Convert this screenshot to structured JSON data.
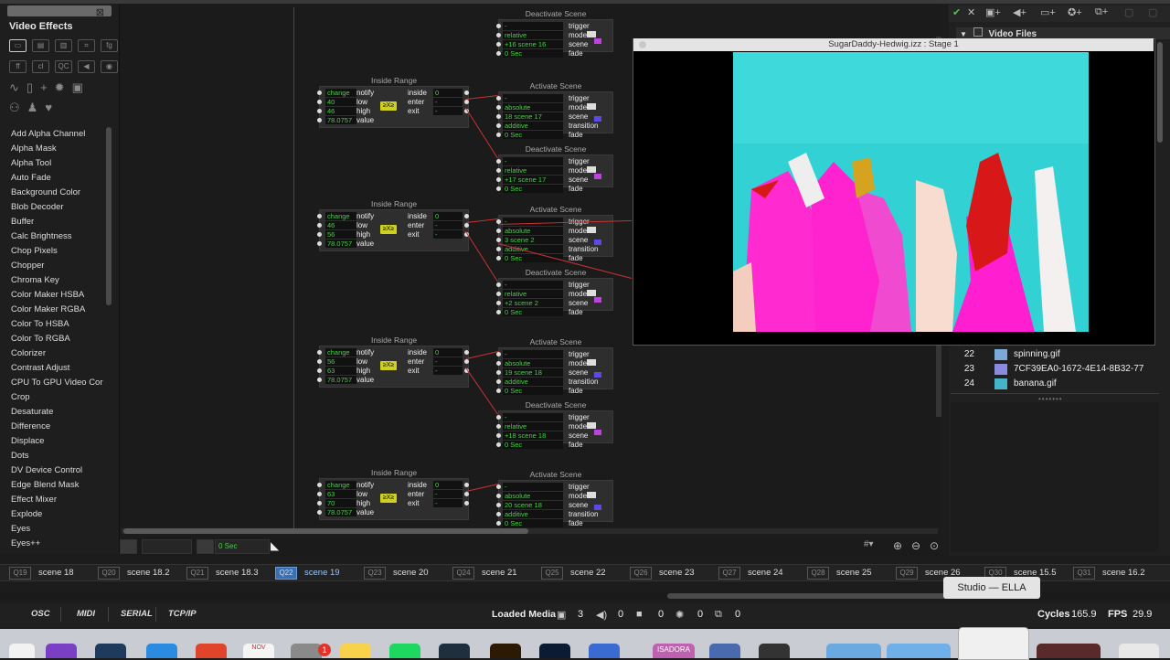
{
  "sidebar": {
    "title": "Video Effects",
    "tools_row1": [
      "▭",
      "▤",
      "▥",
      "⌗",
      "fg"
    ],
    "tools_row2": [
      "ff",
      "cl",
      "QC",
      "◀",
      "◉"
    ],
    "effects": [
      "Add Alpha Channel",
      "Alpha Mask",
      "Alpha Tool",
      "Auto Fade",
      "Background Color",
      "Blob Decoder",
      "Buffer",
      "Calc Brightness",
      "Chop Pixels",
      "Chopper",
      "Chroma Key",
      "Color Maker HSBA",
      "Color Maker RGBA",
      "Color To HSBA",
      "Color To RGBA",
      "Colorizer",
      "Contrast Adjust",
      "CPU To GPU Video Cor",
      "Crop",
      "Desaturate",
      "Difference",
      "Displace",
      "Dots",
      "DV Device Control",
      "Edge Blend Mask",
      "Effect Mixer",
      "Explode",
      "Eyes",
      "Eyes++"
    ]
  },
  "canvas": {
    "inside_range_title": "Inside Range",
    "activate_title": "Activate Scene",
    "deactivate_title": "Deactivate Scene",
    "labels": {
      "change": "change",
      "notify": "notify",
      "low": "low",
      "high": "high",
      "value": "value",
      "inside": "inside",
      "enter": "enter",
      "exit": "exit",
      "trigger": "trigger",
      "mode": "mode",
      "scene": "scene",
      "transition": "transition",
      "fade": "fade",
      "absolute": "absolute",
      "relative": "relative",
      "additive": "additive",
      "zero_sec": "0 Sec",
      "dash": "-",
      "zero": "0"
    },
    "ranges": [
      {
        "low": "40",
        "high": "46",
        "value": "78.0757",
        "act_scene": "18 scene 17",
        "deact_scene": "+17 scene 17"
      },
      {
        "low": "46",
        "high": "56",
        "value": "78.0757",
        "act_scene": "3 scene 2",
        "deact_scene": "+2 scene 2"
      },
      {
        "low": "56",
        "high": "63",
        "value": "78.0757",
        "act_scene": "19 scene 18",
        "deact_scene": "+18 scene 18"
      },
      {
        "low": "63",
        "high": "70",
        "value": "78.0757",
        "act_scene": "20 scene 18",
        "deact_scene": ""
      }
    ],
    "top_deact_scene": "+16 scene 16",
    "badge": "≥X≥"
  },
  "bottom_toolbar": {
    "time_value": "0 Sec",
    "zoom_icons": [
      "zoom-in-icon",
      "zoom-out-icon",
      "zoom-fit-icon"
    ]
  },
  "stage": {
    "title": "SugarDaddy-Hedwig.izz : Stage 1"
  },
  "right_panel": {
    "header": "Video Files",
    "files": [
      {
        "num": "22",
        "name": "spinning.gif"
      },
      {
        "num": "23",
        "name": "7CF39EA0-1672-4E14-8B32-77"
      },
      {
        "num": "24",
        "name": "banana.gif"
      }
    ]
  },
  "scenes": [
    {
      "q": "Q19",
      "name": "scene 18"
    },
    {
      "q": "Q20",
      "name": "scene 18.2"
    },
    {
      "q": "Q21",
      "name": "scene 18.3"
    },
    {
      "q": "Q22",
      "name": "scene 19",
      "selected": true
    },
    {
      "q": "Q23",
      "name": "scene 20"
    },
    {
      "q": "Q24",
      "name": "scene 21"
    },
    {
      "q": "Q25",
      "name": "scene 22"
    },
    {
      "q": "Q26",
      "name": "scene 23"
    },
    {
      "q": "Q27",
      "name": "scene 24"
    },
    {
      "q": "Q28",
      "name": "scene 25"
    },
    {
      "q": "Q29",
      "name": "scene 26"
    },
    {
      "q": "Q30",
      "name": "scene 15.5"
    },
    {
      "q": "Q31",
      "name": "scene 16.2"
    }
  ],
  "tooltip": "Studio — ELLA",
  "status": {
    "tabs": [
      "OSC",
      "MIDI",
      "SERIAL",
      "TCP/IP"
    ],
    "loaded_media_label": "Loaded Media",
    "loaded_media_count": "3",
    "audio_count": "0",
    "video_count": "0",
    "gpu_count": "0",
    "other_count": "0",
    "cycles_label": "Cycles",
    "cycles_value": "165.9",
    "fps_label": "FPS",
    "fps_value": "29.9"
  },
  "dock": {
    "isadora_label": "ISADORA",
    "notification_count": "1",
    "calendar_month": "NOV"
  }
}
